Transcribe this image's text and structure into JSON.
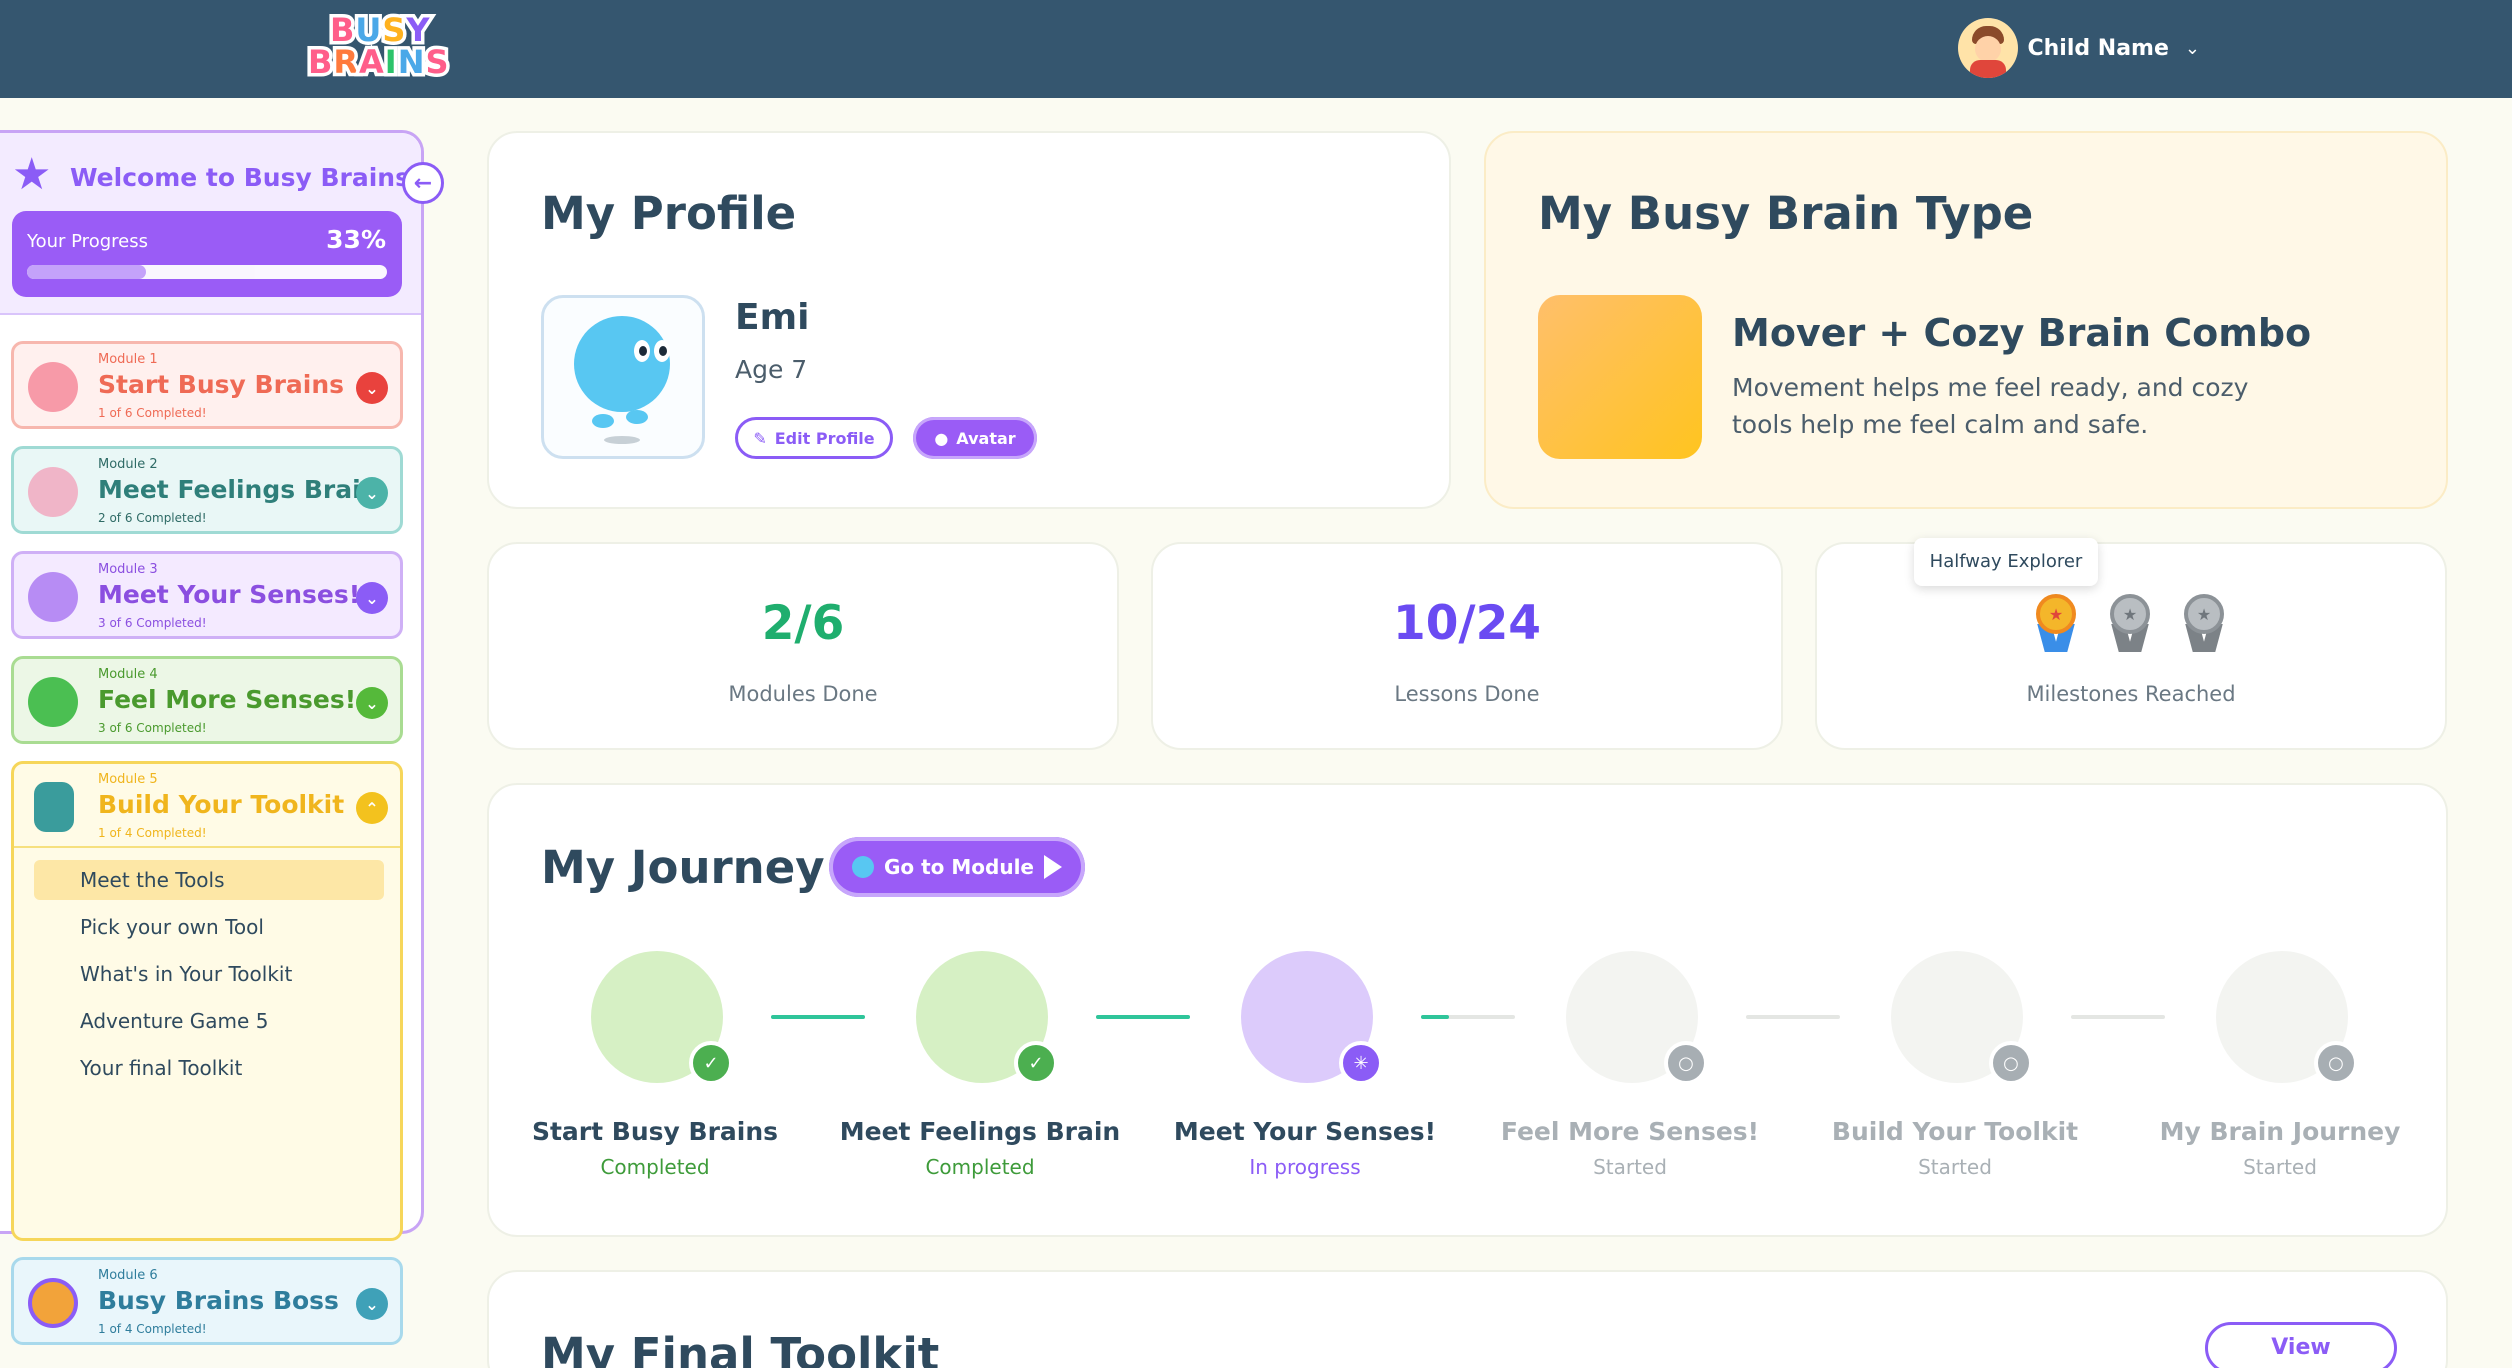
{
  "header": {
    "logo_line1": "BUSY",
    "logo_line2": "BRAINS",
    "user_name": "Child Name"
  },
  "sidebar": {
    "welcome_title": "Welcome to Busy Brains",
    "progress_label": "Your Progress",
    "progress_percent": "33%",
    "progress_value": 0.33,
    "modules": [
      {
        "number": "Module 1",
        "title": "Start Busy Brains",
        "completed": "1 of 6 Completed!",
        "color": "#ef6a55"
      },
      {
        "number": "Module 2",
        "title": "Meet Feelings Brain",
        "completed": "2 of 6 Completed!",
        "color": "#2f7f7a"
      },
      {
        "number": "Module 3",
        "title": "Meet Your Senses!",
        "completed": "3 of 6 Completed!",
        "color": "#8b4fe0"
      },
      {
        "number": "Module 4",
        "title": "Feel More Senses!",
        "completed": "3 of 6 Completed!",
        "color": "#4a9a2e"
      },
      {
        "number": "Module 5",
        "title": "Build Your Toolkit",
        "completed": "1 of 4 Completed!",
        "color": "#f0b51d",
        "lessons": [
          "Meet the Tools",
          "Pick your own Tool",
          "What's in Your Toolkit",
          "Adventure Game 5",
          "Your final Toolkit"
        ]
      },
      {
        "number": "Module 6",
        "title": "Busy Brains Boss",
        "completed": "1 of 4 Completed!",
        "color": "#2f7d9c"
      }
    ]
  },
  "profile": {
    "heading": "My Profile",
    "name": "Emi",
    "age": "Age 7",
    "edit_label": "Edit Profile",
    "avatar_label": "Avatar"
  },
  "brain_type": {
    "heading": "My Busy Brain Type",
    "title": "Mover + Cozy Brain Combo",
    "description": "Movement helps me feel ready, and cozy tools help me feel calm and safe."
  },
  "stats": {
    "modules_value": "2/6",
    "modules_label": "Modules Done",
    "lessons_value": "10/24",
    "lessons_label": "Lessons Done",
    "milestones_label": "Milestones Reached",
    "tooltip": "Halfway Explorer"
  },
  "journey": {
    "heading": "My Journey",
    "go_label": "Go to Module",
    "steps": [
      {
        "name": "Start Busy Brains",
        "status": "Completed"
      },
      {
        "name": "Meet Feelings Brain",
        "status": "Completed"
      },
      {
        "name": "Meet Your Senses!",
        "status": "In progress"
      },
      {
        "name": "Feel More Senses!",
        "status": "Started"
      },
      {
        "name": "Build Your Toolkit",
        "status": "Started"
      },
      {
        "name": "My Brain Journey",
        "status": "Started"
      }
    ]
  },
  "final_toolkit": {
    "heading": "My Final Toolkit",
    "view_label": "View"
  },
  "colors": {
    "header_bg": "#35566f",
    "accent_purple": "#8b5cf6",
    "success_green": "#4caf50"
  }
}
